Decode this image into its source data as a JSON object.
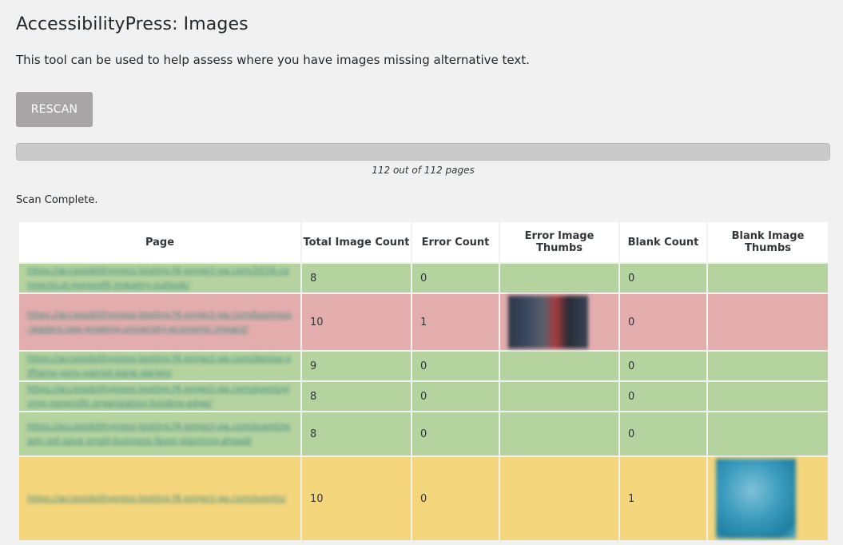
{
  "header": {
    "title": "AccessibilityPress: Images",
    "description": "This tool can be used to help assess where you have images missing alternative text."
  },
  "controls": {
    "rescan_label": "RESCAN"
  },
  "progress": {
    "value": 1.0,
    "text": "112 out of 112 pages"
  },
  "status": "Scan Complete.",
  "colors": {
    "pass": "#b4d39e",
    "error": "#e3adad",
    "warn": "#f4d67d"
  },
  "table": {
    "headers": {
      "page": "Page",
      "total": "Total Image Count",
      "errors": "Error Count",
      "error_thumbs": "Error Image Thumbs",
      "blank": "Blank Count",
      "blank_thumbs": "Blank Image Thumbs"
    },
    "rows": [
      {
        "page": "https://accessibilitypress-testing.f4-project-qa.com/2016-connecticut-nonprofit-industry-outlook/",
        "total": "8",
        "errors": "0",
        "blank": "0"
      },
      {
        "page": "https://accessibilitypress-testing.f4-project-qa.com/business-leaders-see-growing-university-economic-impact/",
        "total": "10",
        "errors": "1",
        "blank": "0"
      },
      {
        "page": "https://accessibilitypress-testing.f4-project-qa.com/denise-giffiams-joins-patriot-bank-darien/",
        "total": "9",
        "errors": "0",
        "blank": "0"
      },
      {
        "page": "https://accessibilitypress-testing.f4-project-qa.com/event/giving-nonprofit-organization-funding-edge/",
        "total": "8",
        "errors": "0",
        "blank": "0"
      },
      {
        "page": "https://accessibilitypress-testing.f4-project-qa.com/event/ready-set-save-small-business-favor-planning-ahead/",
        "total": "8",
        "errors": "0",
        "blank": "0"
      },
      {
        "page": "https://accessibilitypress-testing.f4-project-qa.com/events/",
        "total": "10",
        "errors": "0",
        "blank": "1"
      }
    ]
  }
}
